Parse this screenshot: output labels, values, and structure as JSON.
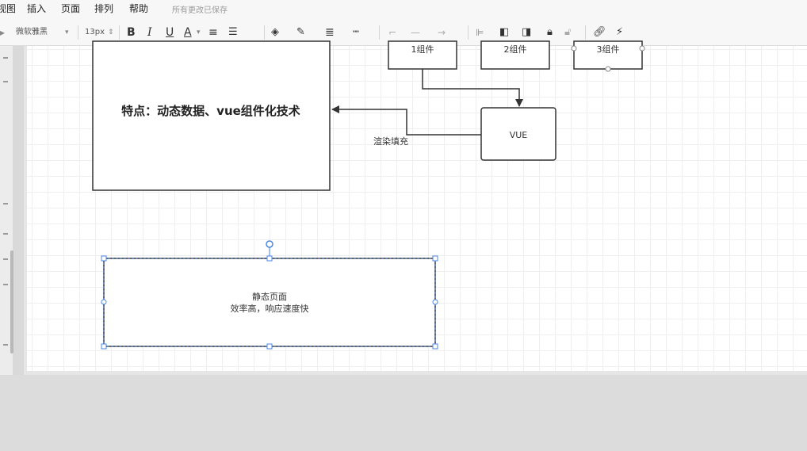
{
  "menu": {
    "items": [
      "视图",
      "插入",
      "页面",
      "排列",
      "帮助"
    ],
    "status": "所有更改已保存"
  },
  "toolbar": {
    "font_family": "微软雅黑",
    "font_size": "13px",
    "bold": "B",
    "italic": "I",
    "underline": "U",
    "font_color": "A"
  },
  "diagram": {
    "main_box_text": "特点：动态数据、vue组件化技术",
    "comp1": "1组件",
    "comp2": "2组件",
    "comp3": "3组件",
    "vue_box": "VUE",
    "edge_label": "渲染填充",
    "static_title": "静态页面",
    "static_sub": "效率高，响应速度快"
  },
  "colors": {
    "selection": "#4a86e8",
    "stroke": "#333333"
  }
}
